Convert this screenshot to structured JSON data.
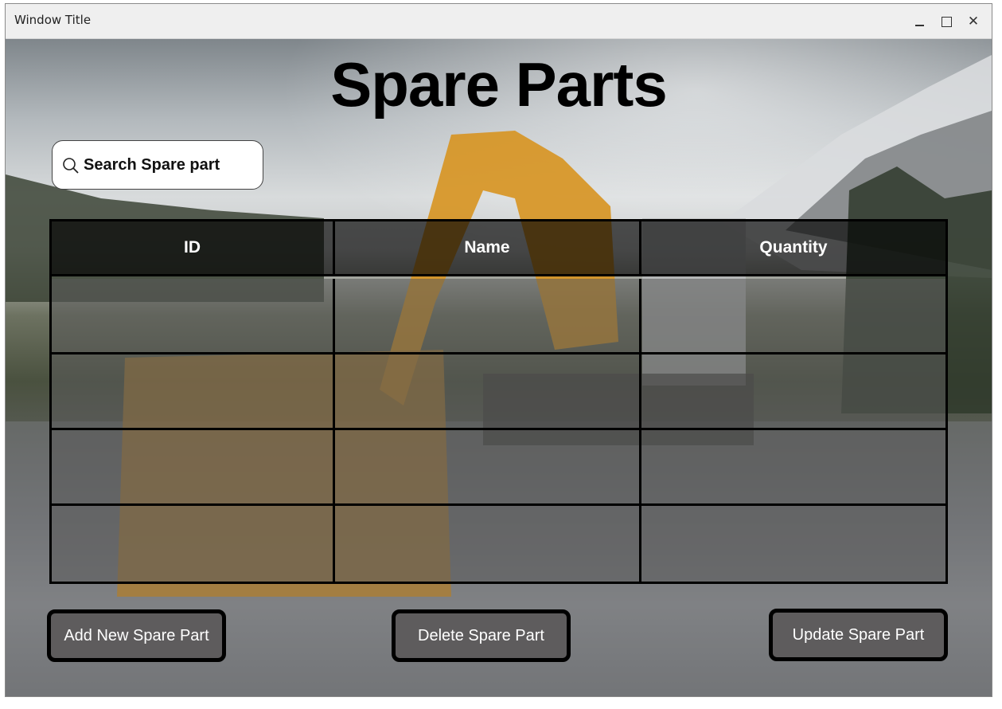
{
  "window": {
    "title": "Window Title",
    "controls": [
      "minimize-icon",
      "maximize-icon",
      "close-icon"
    ],
    "close_glyph": "✕"
  },
  "page": {
    "title": "Spare Parts"
  },
  "search": {
    "placeholder": "Search Spare part",
    "icon": "search-icon"
  },
  "table": {
    "columns": [
      "ID",
      "Name",
      "Quantity"
    ],
    "rows": [
      [
        "",
        "",
        ""
      ],
      [
        "",
        "",
        ""
      ],
      [
        "",
        "",
        ""
      ],
      [
        "",
        "",
        ""
      ]
    ]
  },
  "actions": {
    "add_label": "Add New Spare Part",
    "delete_label": "Delete Spare Part",
    "update_label": "Update Spare Part"
  },
  "colors": {
    "button_bg": "#5e5c5d",
    "header_bg": "#000000",
    "title_color": "#000000"
  }
}
